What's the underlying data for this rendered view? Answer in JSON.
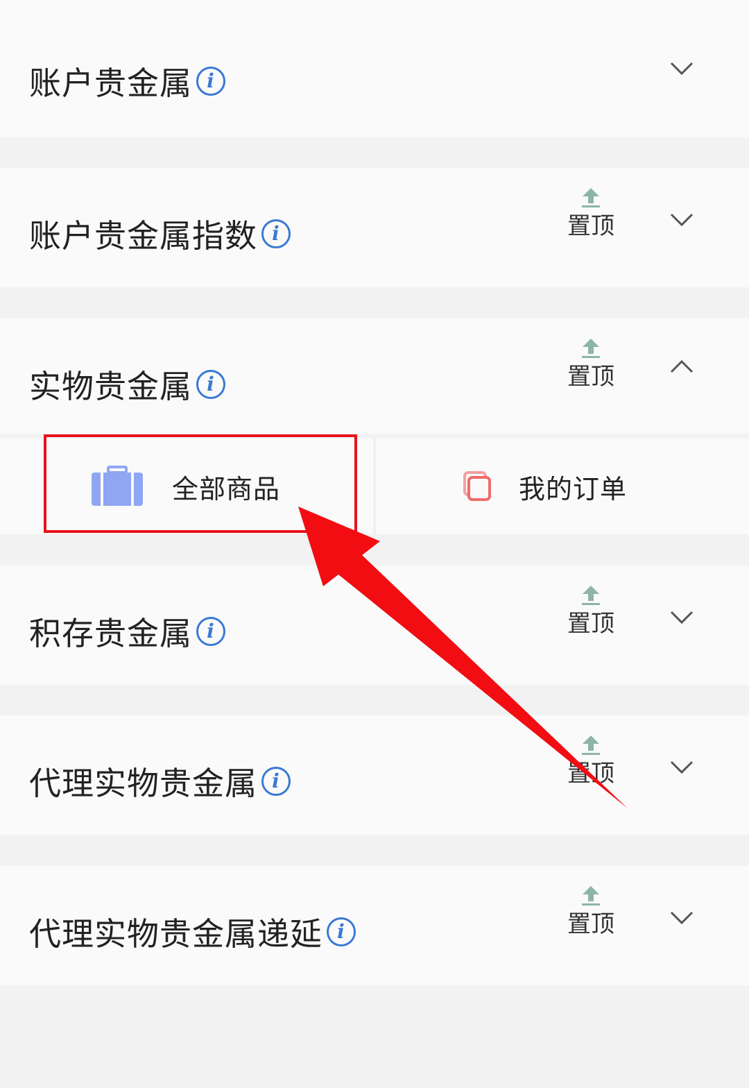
{
  "pin_label": "置顶",
  "sections": [
    {
      "title": "账户贵金属",
      "expanded": false,
      "pinnable": false
    },
    {
      "title": "账户贵金属指数",
      "expanded": false,
      "pinnable": true
    },
    {
      "title": "实物贵金属",
      "expanded": true,
      "pinnable": true
    },
    {
      "title": "积存贵金属",
      "expanded": false,
      "pinnable": true
    },
    {
      "title": "代理实物贵金属",
      "expanded": false,
      "pinnable": true
    },
    {
      "title": "代理实物贵金属递延",
      "expanded": false,
      "pinnable": true
    }
  ],
  "sub_items": [
    {
      "label": "全部商品",
      "icon": "briefcase-icon",
      "color": "#8fa6f2"
    },
    {
      "label": "我的订单",
      "icon": "copy-icon",
      "color": "#f06a6a"
    }
  ],
  "colors": {
    "info": "#3a78d6",
    "pin_arrow": "#8db5a6",
    "annotation_red": "#e8121a",
    "background": "#f2f2f2",
    "card": "#fafafa"
  }
}
